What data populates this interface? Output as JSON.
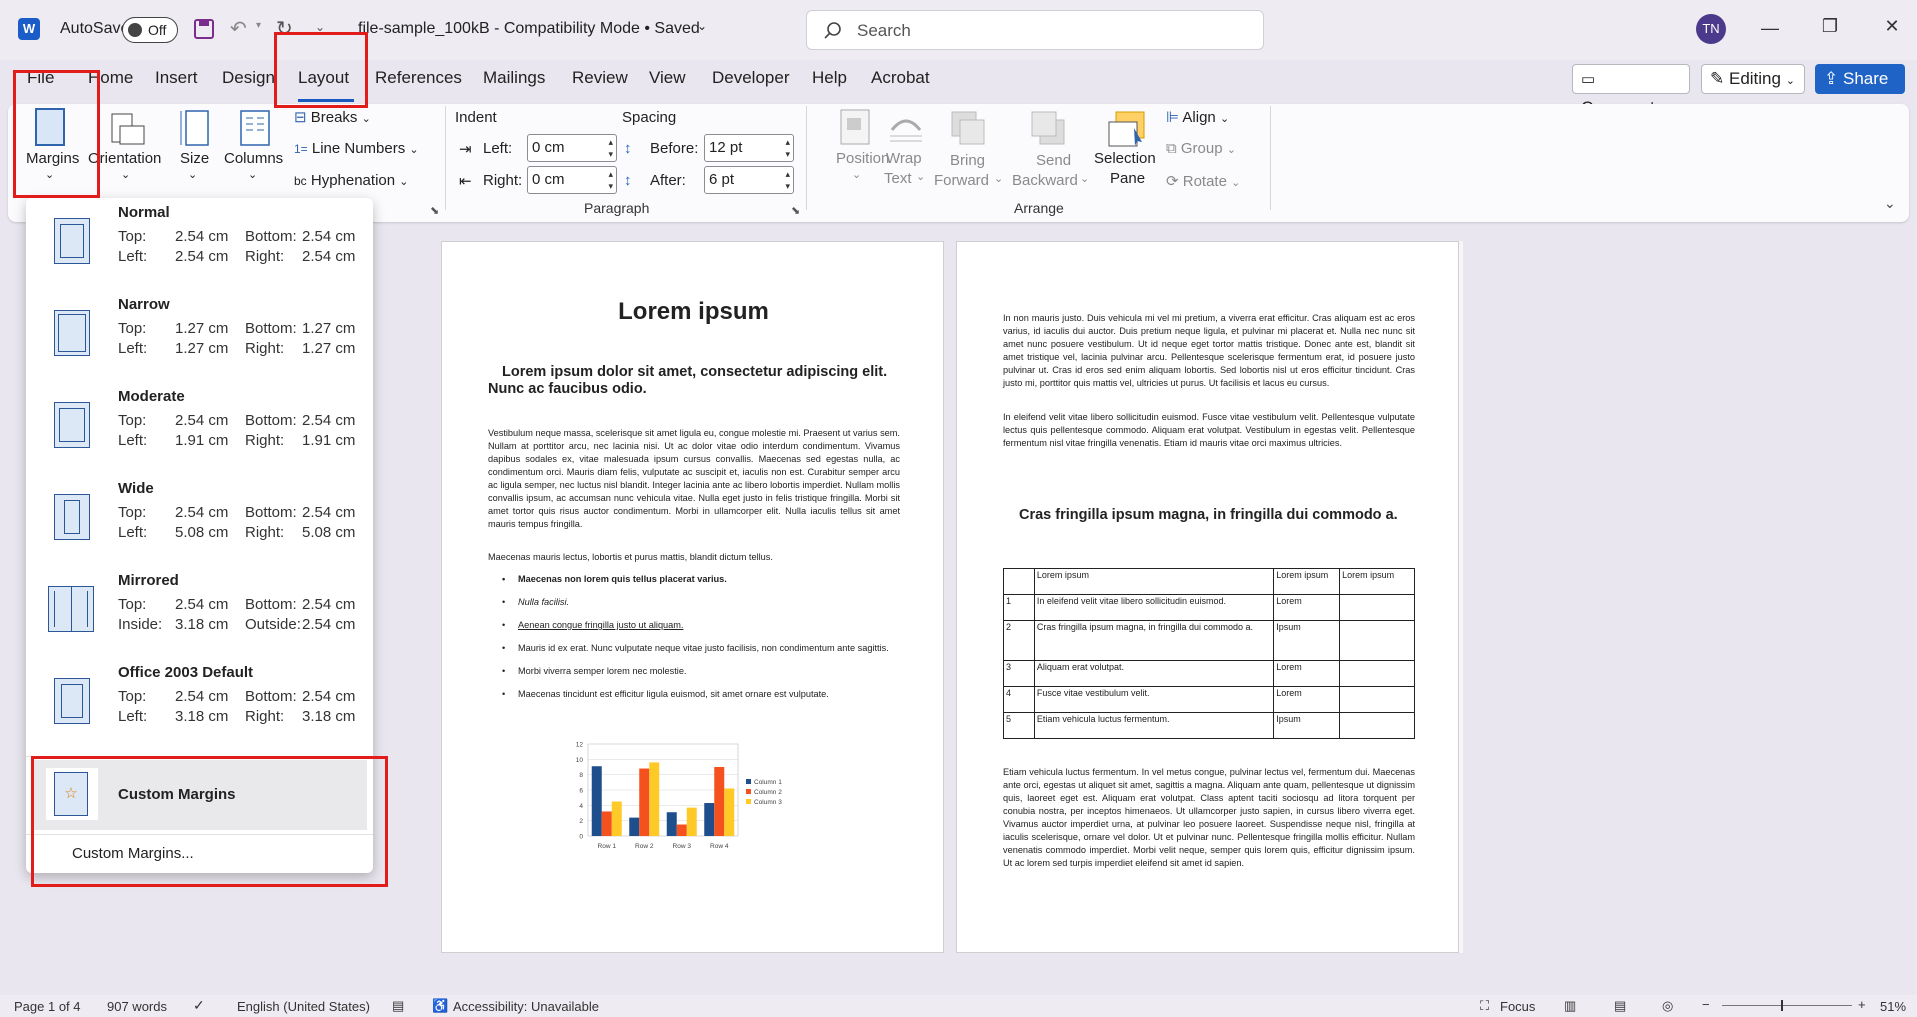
{
  "titlebar": {
    "autosave_label": "AutoSave",
    "autosave_state": "Off",
    "doc_title": "file-sample_100kB  -  Compatibility Mode  •  Saved",
    "search_placeholder": "Search",
    "user_initials": "TN"
  },
  "tabs": [
    "File",
    "Home",
    "Insert",
    "Design",
    "Layout",
    "References",
    "Mailings",
    "Review",
    "View",
    "Developer",
    "Help",
    "Acrobat"
  ],
  "active_tab": "Layout",
  "header_buttons": {
    "comments": "Comments",
    "editing": "Editing",
    "share": "Share"
  },
  "ribbon": {
    "page_setup": {
      "margins": "Margins",
      "orientation": "Orientation",
      "size": "Size",
      "columns": "Columns",
      "breaks": "Breaks",
      "line_numbers": "Line Numbers",
      "hyphenation": "Hyphenation"
    },
    "paragraph": {
      "group_label": "Paragraph",
      "indent_label": "Indent",
      "spacing_label": "Spacing",
      "left_label": "Left:",
      "left_value": "0 cm",
      "right_label": "Right:",
      "right_value": "0 cm",
      "before_label": "Before:",
      "before_value": "12 pt",
      "after_label": "After:",
      "after_value": "6 pt"
    },
    "arrange": {
      "group_label": "Arrange",
      "position": "Position",
      "wrap_text_1": "Wrap",
      "wrap_text_2": "Text",
      "bring_forward_1": "Bring",
      "bring_forward_2": "Forward",
      "send_backward_1": "Send",
      "send_backward_2": "Backward",
      "selection_pane_1": "Selection",
      "selection_pane_2": "Pane",
      "align": "Align",
      "group": "Group",
      "rotate": "Rotate"
    }
  },
  "margins_menu": {
    "items": [
      {
        "name": "Normal",
        "l1": "Top:",
        "v1": "2.54 cm",
        "l2": "Bottom:",
        "v2": "2.54 cm",
        "l3": "Left:",
        "v3": "2.54 cm",
        "l4": "Right:",
        "v4": "2.54 cm"
      },
      {
        "name": "Narrow",
        "l1": "Top:",
        "v1": "1.27 cm",
        "l2": "Bottom:",
        "v2": "1.27 cm",
        "l3": "Left:",
        "v3": "1.27 cm",
        "l4": "Right:",
        "v4": "1.27 cm"
      },
      {
        "name": "Moderate",
        "l1": "Top:",
        "v1": "2.54 cm",
        "l2": "Bottom:",
        "v2": "2.54 cm",
        "l3": "Left:",
        "v3": "1.91 cm",
        "l4": "Right:",
        "v4": "1.91 cm"
      },
      {
        "name": "Wide",
        "l1": "Top:",
        "v1": "2.54 cm",
        "l2": "Bottom:",
        "v2": "2.54 cm",
        "l3": "Left:",
        "v3": "5.08 cm",
        "l4": "Right:",
        "v4": "5.08 cm"
      },
      {
        "name": "Mirrored",
        "l1": "Top:",
        "v1": "2.54 cm",
        "l2": "Bottom:",
        "v2": "2.54 cm",
        "l3": "Inside:",
        "v3": "3.18 cm",
        "l4": "Outside:",
        "v4": "2.54 cm"
      },
      {
        "name": "Office 2003 Default",
        "l1": "Top:",
        "v1": "2.54 cm",
        "l2": "Bottom:",
        "v2": "2.54 cm",
        "l3": "Left:",
        "v3": "3.18 cm",
        "l4": "Right:",
        "v4": "3.18 cm"
      }
    ],
    "custom_item": "Custom Margins",
    "custom_link": "Custom Margins..."
  },
  "page1": {
    "title": "Lorem ipsum",
    "subtitle": "Lorem ipsum dolor sit amet, consectetur adipiscing elit. Nunc ac faucibus odio.",
    "para1": "Vestibulum neque massa, scelerisque sit amet ligula eu, congue molestie mi. Praesent ut varius sem. Nullam at porttitor arcu, nec lacinia nisi. Ut ac dolor vitae odio interdum condimentum. Vivamus dapibus sodales ex, vitae malesuada ipsum cursus convallis. Maecenas sed egestas nulla, ac condimentum orci. Mauris diam felis, vulputate ac suscipit et, iaculis non est. Curabitur semper arcu ac ligula semper, nec luctus nisl blandit. Integer lacinia ante ac libero lobortis imperdiet. Nullam mollis convallis ipsum, ac accumsan nunc vehicula vitae. Nulla eget justo in felis tristique fringilla. Morbi sit amet tortor quis risus auctor condimentum. Morbi in ullamcorper elit. Nulla iaculis tellus sit amet mauris tempus fringilla.",
    "para2": "Maecenas mauris lectus, lobortis et purus mattis, blandit dictum tellus.",
    "bullets": [
      "Maecenas non lorem quis tellus placerat varius.",
      "Nulla facilisi.",
      "Aenean congue fringilla justo ut aliquam.",
      "Mauris id ex erat. Nunc vulputate neque vitae justo facilisis, non condimentum ante sagittis.",
      "Morbi viverra semper lorem nec molestie.",
      "Maecenas tincidunt est efficitur ligula euismod, sit amet ornare est vulputate."
    ]
  },
  "chart_data": {
    "type": "bar",
    "categories": [
      "Row 1",
      "Row 2",
      "Row 3",
      "Row 4"
    ],
    "series": [
      {
        "name": "Column 1",
        "values": [
          9.1,
          2.4,
          3.1,
          4.3
        ],
        "color": "#1f4e8c"
      },
      {
        "name": "Column 2",
        "values": [
          3.2,
          8.8,
          1.5,
          9.0
        ],
        "color": "#f4511e"
      },
      {
        "name": "Column 3",
        "values": [
          4.5,
          9.6,
          3.7,
          6.2
        ],
        "color": "#ffc928"
      }
    ],
    "yticks": [
      "0",
      "2",
      "4",
      "6",
      "8",
      "10",
      "12"
    ],
    "ylim": [
      0,
      12
    ],
    "legend": "right"
  },
  "page2": {
    "para1": "In non mauris justo. Duis vehicula mi vel mi pretium, a viverra erat efficitur. Cras aliquam est ac eros varius, id iaculis dui auctor. Duis pretium neque ligula, et pulvinar mi placerat et. Nulla nec nunc sit amet nunc posuere vestibulum. Ut id neque eget tortor mattis tristique. Donec ante est, blandit sit amet tristique vel, lacinia pulvinar arcu. Pellentesque scelerisque fermentum erat, id posuere justo pulvinar ut. Cras id eros sed enim aliquam lobortis. Sed lobortis nisl ut eros efficitur tincidunt. Cras justo mi, porttitor quis mattis vel, ultricies ut purus. Ut facilisis et lacus eu cursus.",
    "para2": "In eleifend velit vitae libero sollicitudin euismod. Fusce vitae vestibulum velit. Pellentesque vulputate lectus quis pellentesque commodo. Aliquam erat volutpat. Vestibulum in egestas velit. Pellentesque fermentum nisl vitae fringilla venenatis. Etiam id mauris vitae orci maximus ultricies.",
    "heading": "Cras fringilla ipsum magna, in fringilla dui commodo a.",
    "table": [
      [
        "",
        "Lorem ipsum",
        "Lorem ipsum",
        "Lorem ipsum"
      ],
      [
        "1",
        "In eleifend velit vitae libero sollicitudin euismod.",
        "Lorem",
        ""
      ],
      [
        "2",
        "Cras fringilla ipsum magna, in fringilla dui commodo a.",
        "Ipsum",
        ""
      ],
      [
        "3",
        "Aliquam erat volutpat.",
        "Lorem",
        ""
      ],
      [
        "4",
        "Fusce vitae vestibulum velit.",
        "Lorem",
        ""
      ],
      [
        "5",
        "Etiam vehicula luctus fermentum.",
        "Ipsum",
        ""
      ]
    ],
    "para3": "Etiam vehicula luctus fermentum. In vel metus congue, pulvinar lectus vel, fermentum dui. Maecenas ante orci, egestas ut aliquet sit amet, sagittis a magna. Aliquam ante quam, pellentesque ut dignissim quis, laoreet eget est. Aliquam erat volutpat. Class aptent taciti sociosqu ad litora torquent per conubia nostra, per inceptos himenaeos. Ut ullamcorper justo sapien, in cursus libero viverra eget. Vivamus auctor imperdiet urna, at pulvinar leo posuere laoreet. Suspendisse neque nisl, fringilla at iaculis scelerisque, ornare vel dolor. Ut et pulvinar nunc. Pellentesque fringilla mollis efficitur. Nullam venenatis commodo imperdiet. Morbi velit neque, semper quis lorem quis, efficitur dignissim ipsum. Ut ac lorem sed turpis imperdiet eleifend sit amet id sapien."
  },
  "status": {
    "page": "Page 1 of 4",
    "words": "907 words",
    "language": "English (United States)",
    "accessibility": "Accessibility: Unavailable",
    "focus": "Focus",
    "zoom": "51%"
  }
}
